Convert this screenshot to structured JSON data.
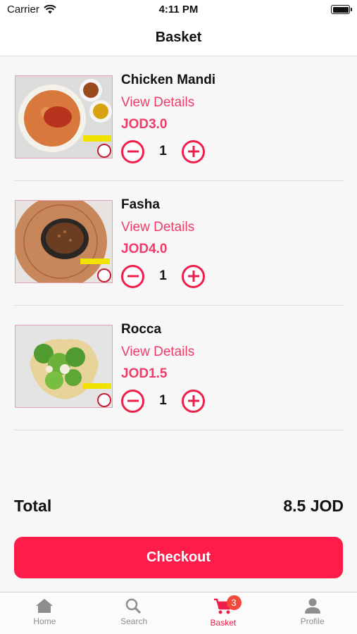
{
  "status_bar": {
    "carrier": "Carrier",
    "time": "4:11 PM"
  },
  "nav": {
    "title": "Basket"
  },
  "colors": {
    "accent": "#ef1f4c",
    "link": "#ee3c67",
    "checkout": "#ff1b4a",
    "badge": "#f24a3d"
  },
  "items": [
    {
      "name": "Chicken Mandi",
      "view_details": "View Details",
      "price": "JOD3.0",
      "quantity": "1",
      "image_icon": "chicken-mandi-photo"
    },
    {
      "name": "Fasha",
      "view_details": "View Details",
      "price": "JOD4.0",
      "quantity": "1",
      "image_icon": "fasha-photo"
    },
    {
      "name": "Rocca",
      "view_details": "View Details",
      "price": "JOD1.5",
      "quantity": "1",
      "image_icon": "rocca-photo"
    }
  ],
  "summary": {
    "total_label": "Total",
    "total_value": "8.5 JOD",
    "checkout_label": "Checkout"
  },
  "tabs": [
    {
      "label": "Home",
      "icon": "home-icon"
    },
    {
      "label": "Search",
      "icon": "search-icon"
    },
    {
      "label": "Basket",
      "icon": "cart-icon",
      "badge": "3",
      "active": true
    },
    {
      "label": "Profile",
      "icon": "person-icon"
    }
  ]
}
